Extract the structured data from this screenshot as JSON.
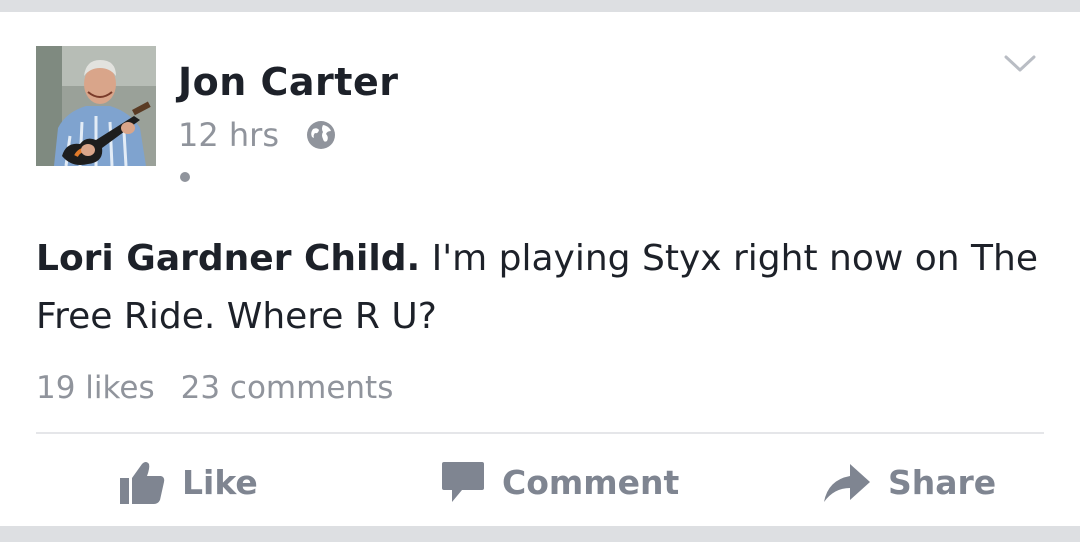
{
  "post": {
    "author": "Jon Carter",
    "time": "12 hrs",
    "mention": "Lori Gardner Child.",
    "text": " I'm playing Styx right now on The Free Ride. Where R U?",
    "likes": "19 likes",
    "comments": "23 comments"
  },
  "actions": {
    "like": "Like",
    "comment": "Comment",
    "share": "Share"
  },
  "icons": {
    "privacy": "globe-icon",
    "menu": "chevron-down-icon",
    "like": "thumbs-up-icon",
    "comment": "comment-bubble-icon",
    "share": "share-arrow-icon"
  },
  "colors": {
    "text": "#1d2129",
    "meta": "#90949c",
    "action": "#7f8591",
    "background": "#dddfe2"
  }
}
